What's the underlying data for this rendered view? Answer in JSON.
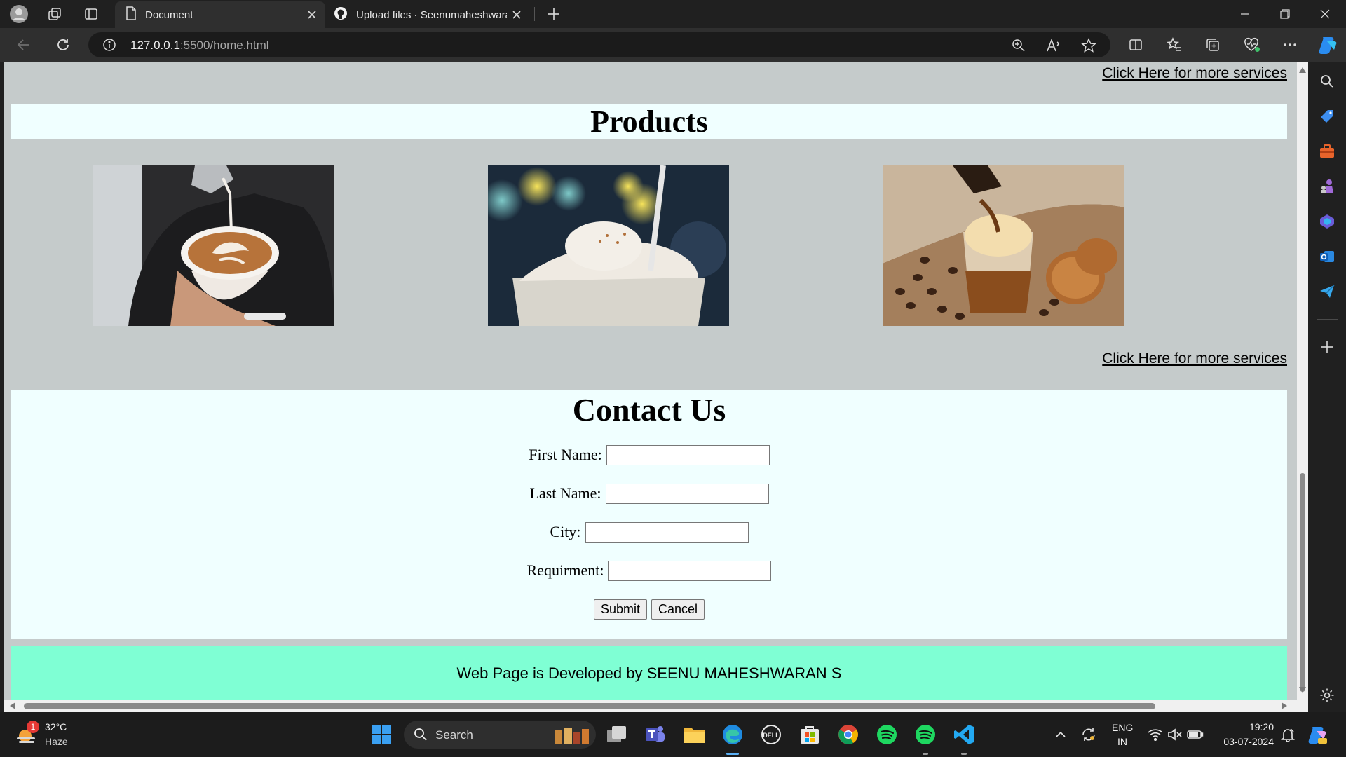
{
  "browser": {
    "tabs": [
      {
        "title": "Document",
        "active": true
      },
      {
        "title": "Upload files · Seenumaheshwaran",
        "active": false
      }
    ],
    "url_host": "127.0.0.1",
    "url_rest": ":5500/home.html"
  },
  "page": {
    "services_link_text": "Click Here for more services",
    "products_title": "Products",
    "product_images": [
      "latte-art-cup",
      "iced-coffee-float",
      "affogato-with-cookies"
    ],
    "contact_title": "Contact Us",
    "form": {
      "first_name_label": "First Name:",
      "last_name_label": "Last Name:",
      "city_label": "City:",
      "requirement_label": "Requirment:",
      "first_name_value": "",
      "last_name_value": "",
      "city_value": "",
      "requirement_value": "",
      "submit_label": "Submit",
      "cancel_label": "Cancel"
    },
    "footer_text": "Web Page is Developed by SEENU MAHESHWARAN S"
  },
  "taskbar": {
    "weather_temp": "32°C",
    "weather_desc": "Haze",
    "weather_badge": "1",
    "search_label": "Search",
    "lang_top": "ENG",
    "lang_bottom": "IN",
    "time": "19:20",
    "date": "03-07-2024"
  },
  "colors": {
    "page_bg": "#c5cbcb",
    "section_bg": "#f0ffff",
    "footer_bg": "#7fffd4",
    "browser_chrome": "#202020"
  }
}
